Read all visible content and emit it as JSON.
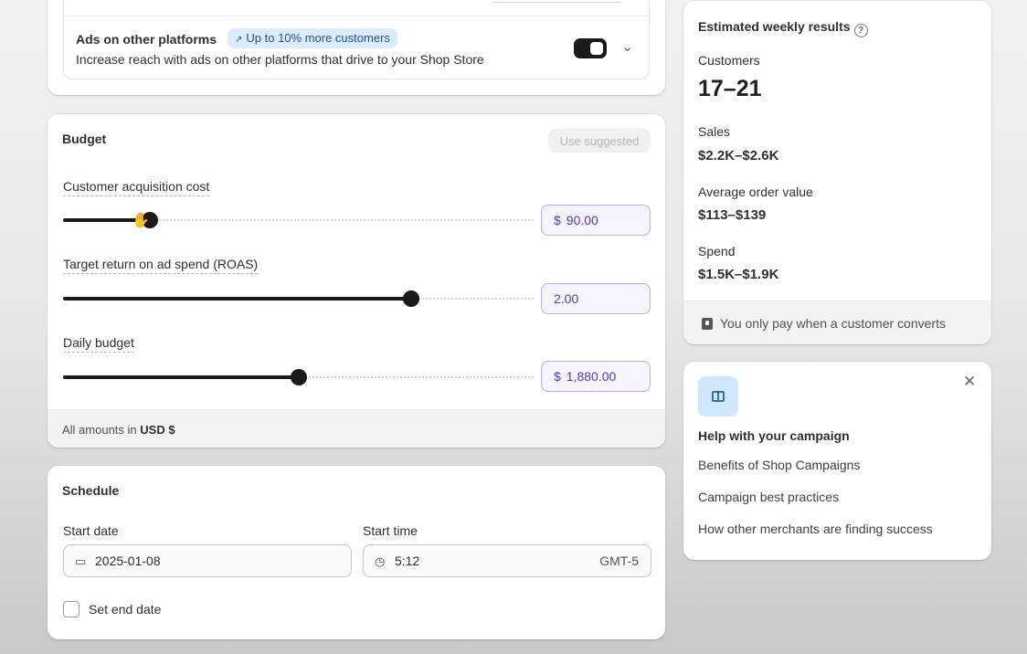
{
  "ads_other_platforms": {
    "title": "Ads on other platforms",
    "badge": "Up to 10% more customers",
    "description": "Increase reach with ads on other platforms that drive to your Shop Store",
    "enabled": true
  },
  "budget": {
    "title": "Budget",
    "use_suggested": "Use suggested",
    "sliders": [
      {
        "label": "Customer acquisition cost",
        "currency": "$",
        "value": "90.00",
        "fraction": 0.185
      },
      {
        "label": "Target return on ad spend (ROAS)",
        "currency": "",
        "value": "2.00",
        "fraction": 0.74
      },
      {
        "label": "Daily budget",
        "currency": "$",
        "value": "1,880.00",
        "fraction": 0.5
      }
    ],
    "footer_prefix": "All amounts in",
    "footer_currency": "USD $"
  },
  "schedule": {
    "title": "Schedule",
    "start_date_label": "Start date",
    "start_date_value": "2025-01-08",
    "start_time_label": "Start time",
    "start_time_value": "5:12",
    "timezone": "GMT-5",
    "end_date_label": "Set end date"
  },
  "results": {
    "title": "Estimated weekly results",
    "customers_label": "Customers",
    "customers_value": "17–21",
    "sales_label": "Sales",
    "sales_value": "$2.2K–$2.6K",
    "aov_label": "Average order value",
    "aov_value": "$113–$139",
    "spend_label": "Spend",
    "spend_value": "$1.5K–$1.9K",
    "footer": "You only pay when a customer converts"
  },
  "help": {
    "title": "Help with your campaign",
    "links": [
      "Benefits of Shop Campaigns",
      "Campaign best practices",
      "How other merchants are finding success"
    ]
  },
  "colors": {
    "accent_purple": "#4b3bc4",
    "badge_bg": "#dcecff",
    "badge_text": "#1f4fa3"
  }
}
